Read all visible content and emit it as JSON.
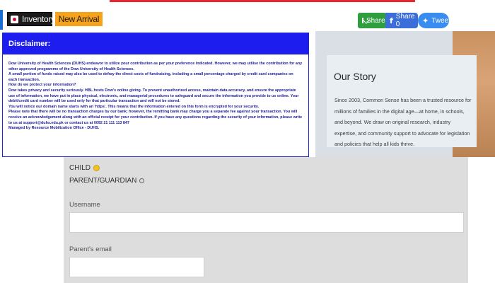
{
  "header": {
    "inventory_label": "Inventory",
    "new_arrival_label": "New Arrival",
    "flag_icon": "japan-flag-icon"
  },
  "share": {
    "email_label": "Share",
    "facebook_label": "Share 0",
    "tweet_label": "Tweet",
    "colors": {
      "email": "#2e9e3f",
      "facebook": "#3b6ed8",
      "tweet": "#3a8df0"
    }
  },
  "disclaimer": {
    "title": "Disclaimer:",
    "paragraphs": [
      "Dow University of Health Sciences (DUHS) endeavor to utilize your contribution as per your preference indicated. However, we may utilise the contribution for any other approved programme of the Dow University of Health Sciences.",
      "A small portion of funds raised may also be used to defray the direct costs of fundraising, including a small percentage charged by credit card companies on each transaction.",
      "How do we protect your information?",
      "Dow takes privacy and security seriously. HBL hosts Dow's online giving. To prevent unauthorized access, maintain data accuracy, and ensure the appropriate use of information, we have put in place physical, electronic, and managerial procedures to safeguard and secure the information you provide to us online. Your debit/credit card number will be used only for that particular transaction and will not be stored.",
      "You will notice our domain name starts with an 'https'. This means that the information entered on this form is encrypted for your security.",
      "Please note that there will be no transaction charges by our bank; however, the remitting bank may charge you a separate fee against your transaction. You will receive an acknowledgement along with an official receipt for your contribution. If you have any questions regarding the security of your information, please write to us at support@duhs.edu.pk or contact us at 0092 21 111 113 847",
      "Managed by Resource Mobilization Office - DUHS."
    ],
    "colors": {
      "header_bg": "#1d1df0",
      "text": "#1c1c9a"
    }
  },
  "story": {
    "title": "Our Story",
    "text": "Since 2003, Common Sense has been a trusted resource for millions of families in the digital age—at home, in schools, and beyond. We draw on original research, industry expertise, and community support to advocate for legislation and policies that help all kids thrive."
  },
  "form": {
    "child_option": "CHILD",
    "parent_option": "PARENT/GUARDIAN",
    "selected_option": "CHILD",
    "username_label": "Username",
    "username_value": "",
    "email_label": "Parent's email",
    "email_value": ""
  }
}
